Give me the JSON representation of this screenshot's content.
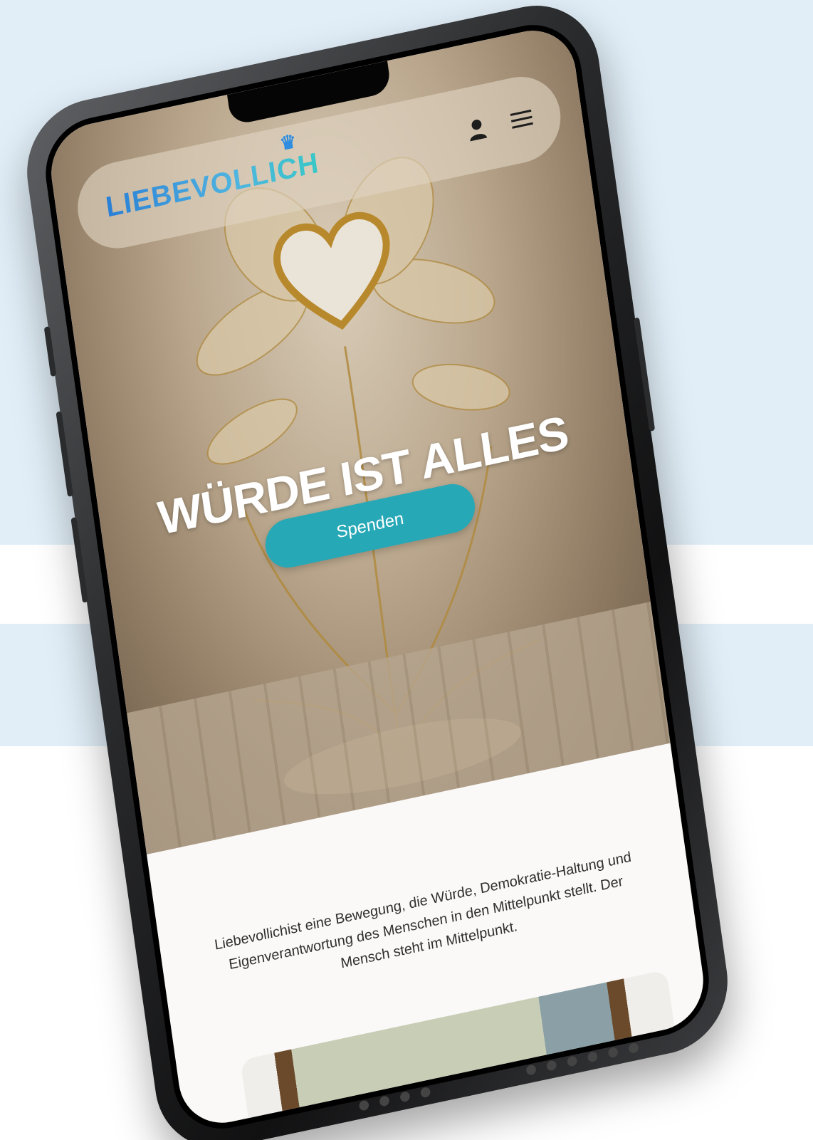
{
  "site": {
    "logo_text": "LIEBEVOLLICH",
    "nav": {
      "account_icon": "user-icon",
      "menu_icon": "hamburger-menu-icon"
    }
  },
  "hero": {
    "headline": "WÜRDE IST ALLES",
    "cta_label": "Spenden"
  },
  "about": {
    "text": "Liebevollichist eine Bewegung, die Würde, Demokratie-Haltung und Eigenverantwortung des Menschen in den Mittelpunkt stellt. Der Mensch steht im Mittelpunkt."
  },
  "colors": {
    "accent": "#27a8b6",
    "logo_blue": "#2a7fd6",
    "background_band": "#e1eef7"
  }
}
